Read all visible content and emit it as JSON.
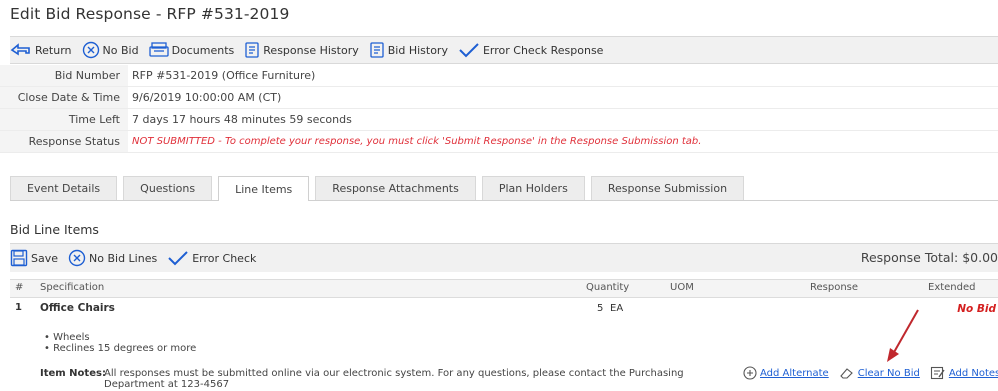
{
  "page": {
    "title": "Edit Bid Response - RFP #531-2019"
  },
  "toolbar": {
    "return_label": "Return",
    "nobid_label": "No Bid",
    "documents_label": "Documents",
    "response_history_label": "Response History",
    "bid_history_label": "Bid History",
    "error_check_label": "Error Check Response"
  },
  "info": [
    {
      "label": "Bid Number",
      "value": "RFP #531-2019 (Office Furniture)"
    },
    {
      "label": "Close Date & Time",
      "value": "9/6/2019 10:00:00 AM (CT)"
    },
    {
      "label": "Time Left",
      "value": "7 days 17 hours 48 minutes 59 seconds"
    },
    {
      "label": "Response Status",
      "value": "NOT SUBMITTED - To complete your response, you must click 'Submit Response' in the Response Submission tab."
    }
  ],
  "tabs": [
    {
      "label": "Event Details"
    },
    {
      "label": "Questions"
    },
    {
      "label": "Line Items"
    },
    {
      "label": "Response Attachments"
    },
    {
      "label": "Plan Holders"
    },
    {
      "label": "Response Submission"
    }
  ],
  "active_tab": "Line Items",
  "section": {
    "title": "Bid Line Items"
  },
  "line_toolbar": {
    "save_label": "Save",
    "nobid_lines_label": "No Bid Lines",
    "error_check_label": "Error Check",
    "response_total": "Response Total: $0.00"
  },
  "grid": {
    "headers": {
      "num": "#",
      "spec": "Specification",
      "qty": "Quantity",
      "uom": "UOM",
      "response": "Response",
      "extended": "Extended"
    },
    "row": {
      "num": "1",
      "spec": "Office Chairs",
      "qty": "5",
      "uom": "EA",
      "extended": "No Bid",
      "bullets": [
        "Wheels",
        "Reclines 15 degrees or more"
      ],
      "notes_label": "Item Notes:",
      "notes_text": "All responses must be submitted online via our electronic system. For any questions, please contact the Purchasing Department at 123-4567",
      "add_alternate": "Add Alternate",
      "clear_no_bid": "Clear No Bid",
      "add_notes": "Add Notes"
    }
  },
  "colors": {
    "accent": "#1e5fd3",
    "warning": "#e0303a",
    "arrow": "#c0282d"
  }
}
